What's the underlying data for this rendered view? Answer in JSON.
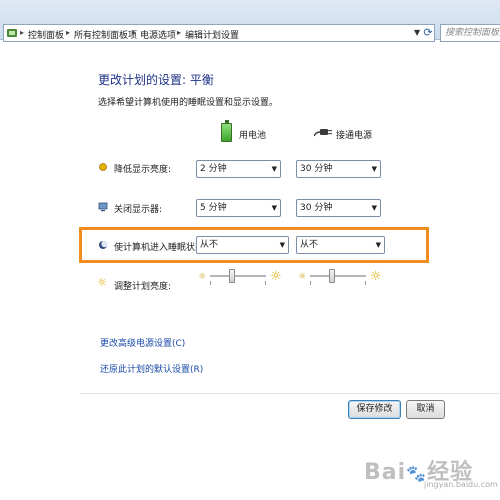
{
  "address_bar": {
    "crumbs": [
      "控制面板",
      "所有控制面板项",
      "电源选项",
      "编辑计划设置"
    ],
    "search_placeholder": "搜索控制面板"
  },
  "header": {
    "title": "更改计划的设置: 平衡",
    "subtitle": "选择希望计算机使用的睡眠设置和显示设置。"
  },
  "columns": {
    "battery": "用电池",
    "plugged_in": "接通电源"
  },
  "rows": {
    "dim_display": {
      "label": "降低显示亮度:",
      "battery": "2 分钟",
      "plugged": "30 分钟"
    },
    "turn_off_display": {
      "label": "关闭显示器:",
      "battery": "5 分钟",
      "plugged": "30 分钟"
    },
    "sleep": {
      "label": "使计算机进入睡眠状态:",
      "battery": "从不",
      "plugged": "从不"
    },
    "brightness": {
      "label": "调整计划亮度:",
      "battery_level": 0.4,
      "plugged_level": 0.4
    }
  },
  "links": {
    "advanced": "更改高级电源设置(C)",
    "restore": "还原此计划的默认设置(R)"
  },
  "buttons": {
    "save": "保存修改",
    "cancel": "取消"
  },
  "watermark": {
    "brand": "Bai",
    "brand_suffix": "经验",
    "url": "jingyan.baidu.com"
  },
  "colors": {
    "title": "#1e3287",
    "link": "#1a4aa8",
    "highlight": "#f18d1f"
  }
}
